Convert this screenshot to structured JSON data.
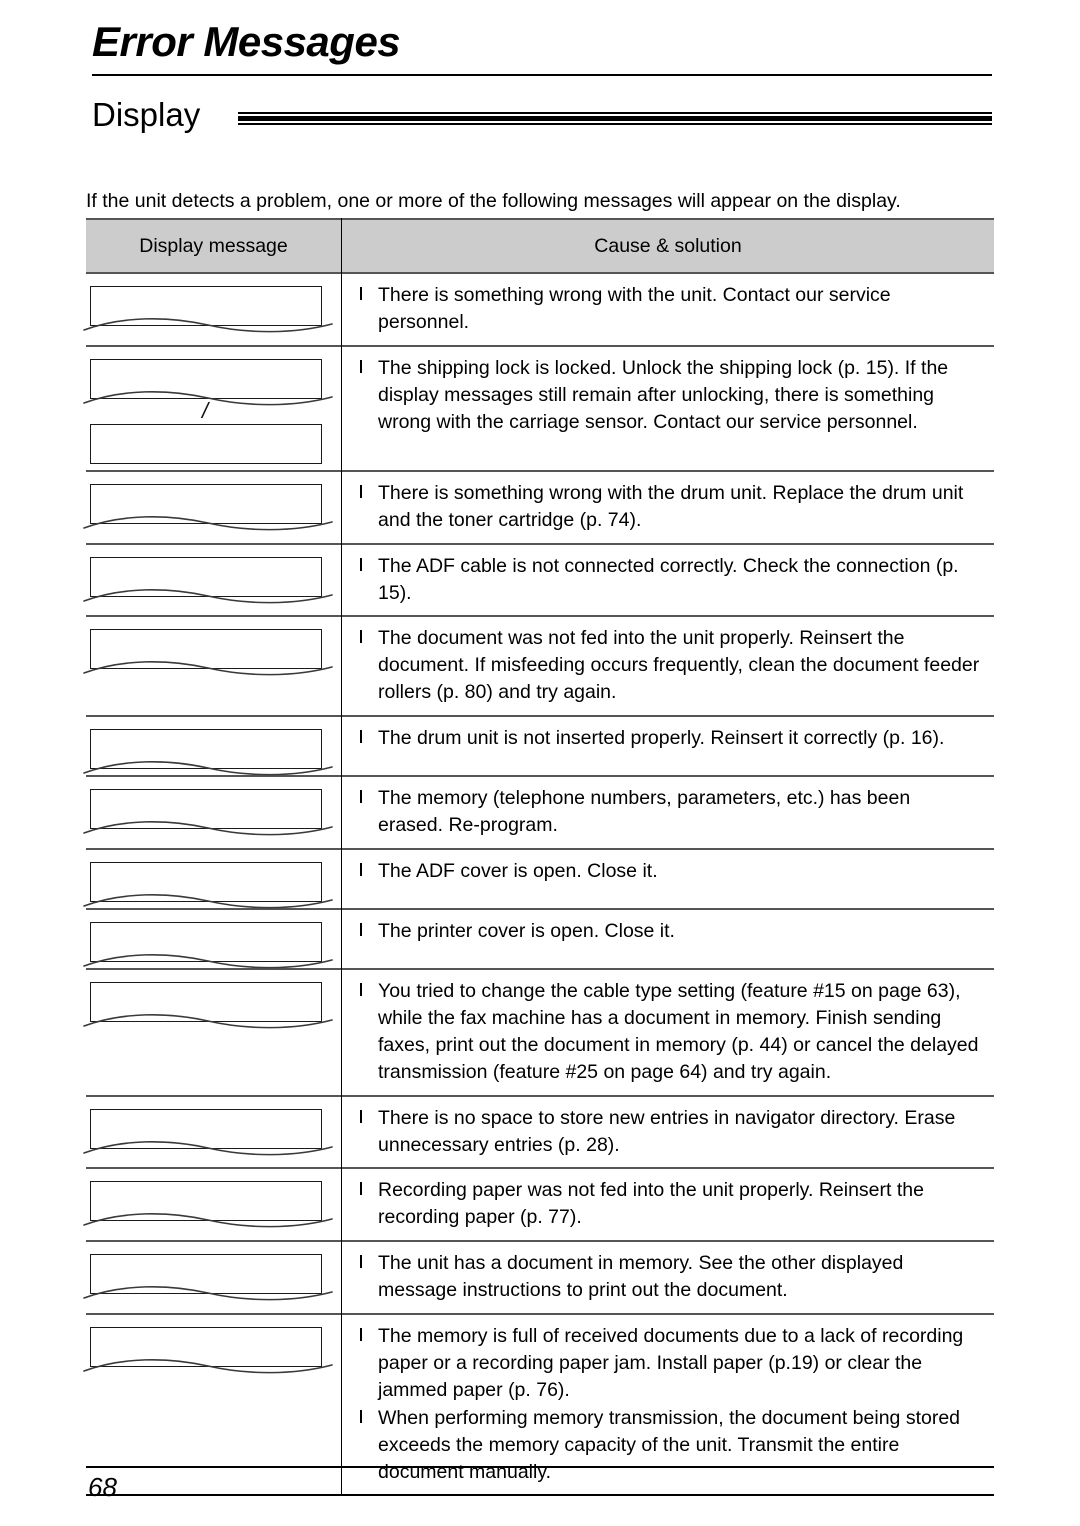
{
  "chapter": {
    "title": "Error Messages"
  },
  "section": {
    "heading": "Display"
  },
  "intro": "If the unit detects a problem, one or more of the following messages will appear on the display.",
  "table": {
    "headers": {
      "left": "Display message",
      "right": "Cause & solution"
    },
    "separator": "/",
    "rows": [
      {
        "displays": 1,
        "causes": [
          "There is something wrong with the unit. Contact our service personnel."
        ]
      },
      {
        "displays": 2,
        "causes": [
          "The shipping lock is locked. Unlock the shipping lock (p. 15). If the display messages still remain after unlocking, there is something wrong with the carriage sensor. Contact our service personnel."
        ]
      },
      {
        "displays": 1,
        "causes": [
          "There is something wrong with the drum unit. Replace the drum unit and the toner cartridge (p. 74)."
        ]
      },
      {
        "displays": 1,
        "causes": [
          "The ADF cable is not connected correctly. Check the connection (p. 15)."
        ]
      },
      {
        "displays": 1,
        "causes": [
          "The document was not fed into the unit properly. Reinsert the document. If misfeeding occurs frequently, clean the document feeder rollers (p. 80) and try again."
        ]
      },
      {
        "displays": 1,
        "causes": [
          "The drum unit is not inserted properly. Reinsert it correctly (p. 16)."
        ]
      },
      {
        "displays": 1,
        "causes": [
          "The memory (telephone numbers, parameters, etc.) has been erased. Re-program."
        ]
      },
      {
        "displays": 1,
        "causes": [
          "The ADF cover is open. Close it."
        ]
      },
      {
        "displays": 1,
        "causes": [
          "The printer cover is open. Close it."
        ]
      },
      {
        "displays": 1,
        "causes": [
          "You tried to change the cable type setting (feature #15 on page 63), while the fax machine has a document in memory. Finish sending faxes, print out the document in memory (p. 44) or cancel the delayed transmission (feature #25 on page 64) and try again."
        ]
      },
      {
        "displays": 1,
        "causes": [
          "There is no space to store new entries in navigator directory. Erase unnecessary entries (p. 28)."
        ]
      },
      {
        "displays": 1,
        "causes": [
          "Recording paper was not fed into the unit properly. Reinsert the recording paper (p. 77)."
        ]
      },
      {
        "displays": 1,
        "causes": [
          "The unit has a document in memory. See the other displayed message instructions to print out the document."
        ]
      },
      {
        "displays": 1,
        "causes": [
          "The memory is full of received documents due to a lack of recording paper or a recording paper jam. Install paper (p.19) or clear the jammed paper (p. 76).",
          "When performing memory transmission, the document being stored exceeds the memory capacity of the unit. Transmit the entire document manually."
        ]
      }
    ]
  },
  "footer": {
    "page_number": "68"
  }
}
